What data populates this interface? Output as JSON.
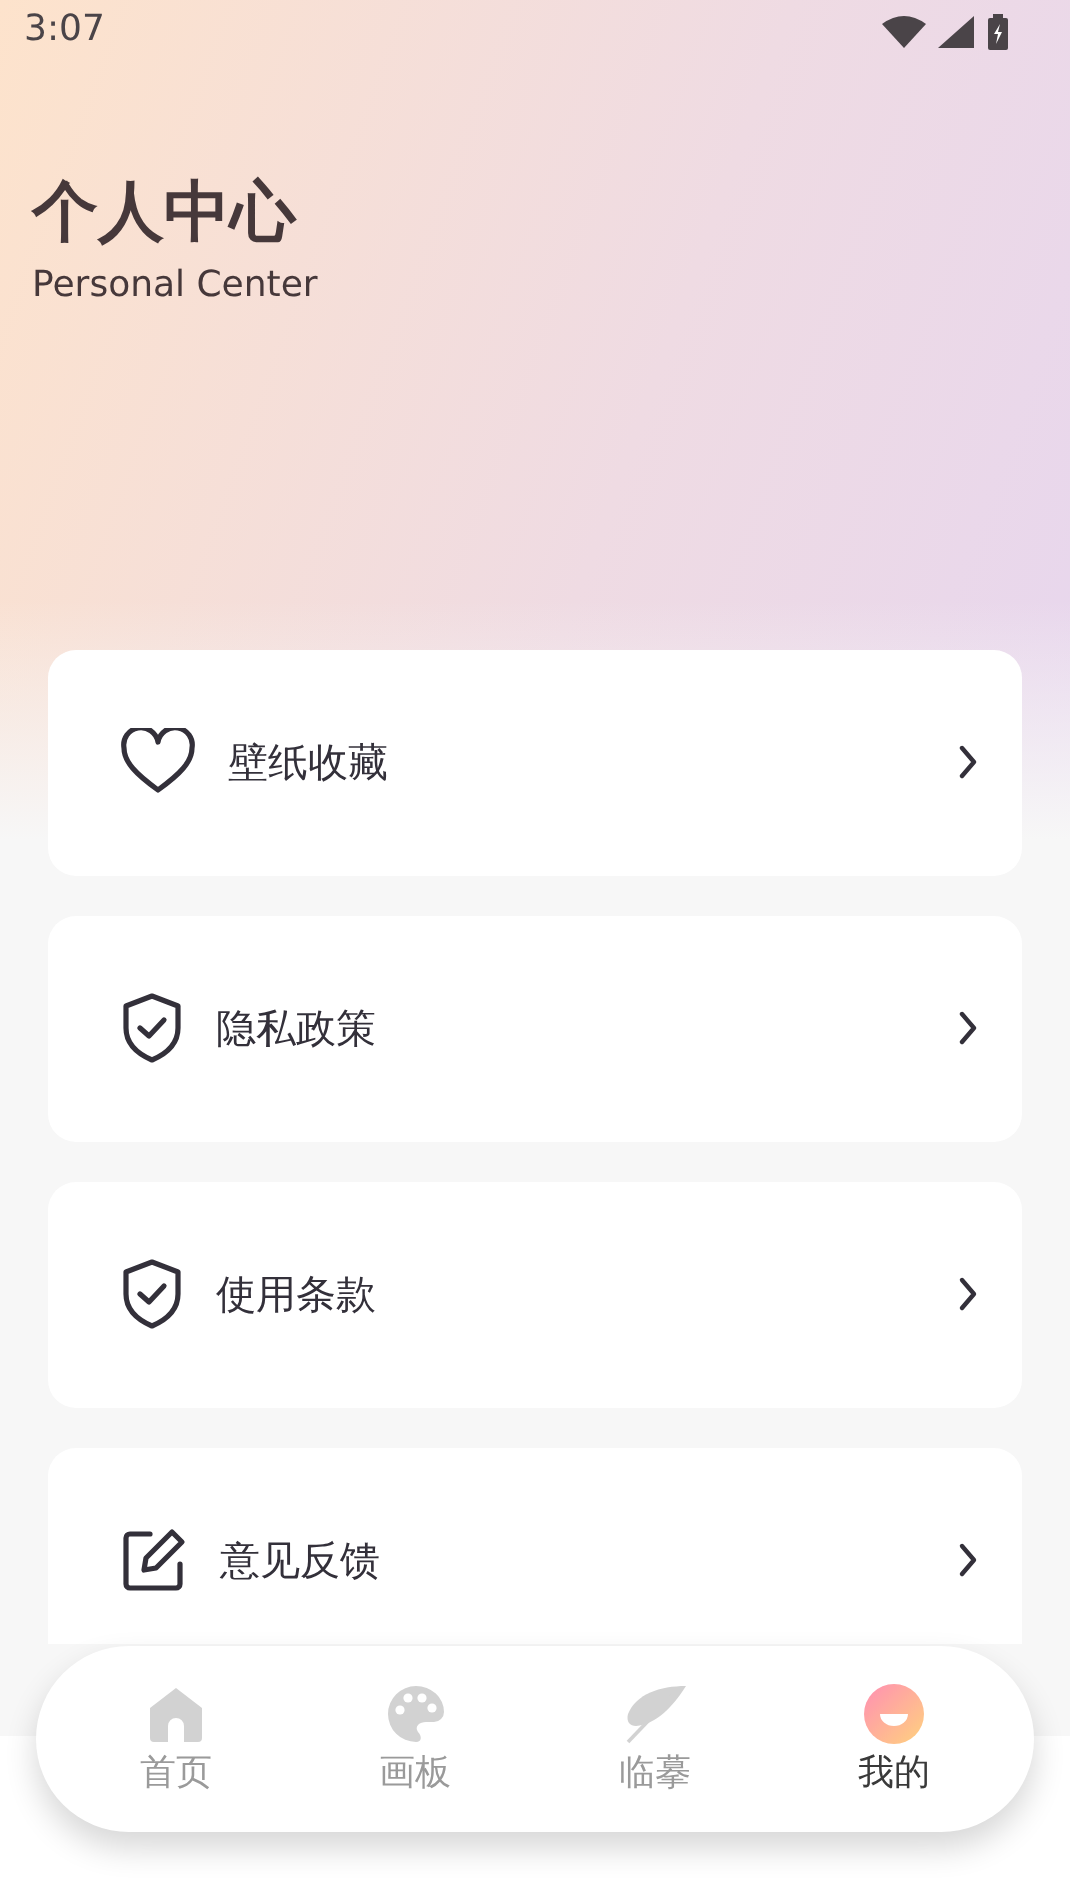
{
  "status_bar": {
    "time": "3:07"
  },
  "header": {
    "title": "个人中心",
    "subtitle": "Personal Center"
  },
  "menu": [
    {
      "kind": "heart",
      "label": "壁纸收藏"
    },
    {
      "kind": "shield",
      "label": "隐私政策"
    },
    {
      "kind": "shield",
      "label": "使用条款"
    },
    {
      "kind": "edit",
      "label": "意见反馈"
    }
  ],
  "tab_bar": [
    {
      "kind": "home",
      "label": "首页",
      "selected": false
    },
    {
      "kind": "palette",
      "label": "画板",
      "selected": false
    },
    {
      "kind": "feather",
      "label": "临摹",
      "selected": false
    },
    {
      "kind": "profile",
      "label": "我的",
      "selected": true
    }
  ]
}
